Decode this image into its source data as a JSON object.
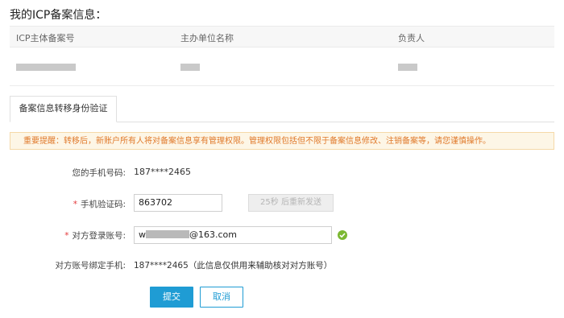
{
  "page": {
    "title": "我的ICP备案信息："
  },
  "icp_table": {
    "columns": [
      "ICP主体备案号",
      "主办单位名称",
      "负责人"
    ]
  },
  "tabs": [
    {
      "label": "备案信息转移身份验证",
      "active": true
    }
  ],
  "notice": {
    "text": "重要提醒：转移后，新账户所有人将对备案信息享有管理权限。管理权限包括但不限于备案信息修改、注销备案等，请您谨慎操作。"
  },
  "form": {
    "phone": {
      "label": "您的手机号码:",
      "value": "187****2465"
    },
    "code": {
      "required_mark": "*",
      "label": "手机验证码:",
      "value": "863702",
      "resend_label": "25秒 后重新发送"
    },
    "account": {
      "required_mark": "*",
      "label": "对方登录账号:",
      "value_prefix": "w",
      "value_suffix": "@163.com",
      "status_icon": "check-circle-icon"
    },
    "bound_phone": {
      "label": "对方账号绑定手机:",
      "value": "187****2465（此信息仅供用来辅助核对对方账号）"
    }
  },
  "actions": {
    "submit_label": "提交",
    "cancel_label": "取消"
  },
  "colors": {
    "primary": "#1f9cd4",
    "success": "#7cb832",
    "warning_text": "#e0792b",
    "warning_bg": "#fdf6e6",
    "required": "#e4393c"
  }
}
